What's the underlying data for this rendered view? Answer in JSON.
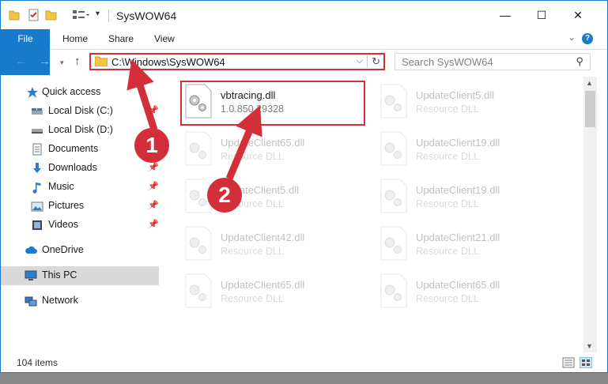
{
  "window": {
    "title": "SysWOW64",
    "controls": {
      "minimize": "—",
      "maximize": "☐",
      "close": "✕"
    }
  },
  "ribbon": {
    "tabs": [
      "File",
      "Home",
      "Share",
      "View"
    ],
    "help": "?"
  },
  "address": {
    "path": "C:\\Windows\\SysWOW64",
    "search_placeholder": "Search SysWOW64"
  },
  "sidebar": {
    "items": [
      {
        "label": "Quick access",
        "icon": "star-icon"
      },
      {
        "label": "Local Disk (C:)",
        "icon": "drive-icon",
        "pinned": true
      },
      {
        "label": "Local Disk (D:)",
        "icon": "drive-icon"
      },
      {
        "label": "Documents",
        "icon": "documents-icon",
        "pinned": true
      },
      {
        "label": "Downloads",
        "icon": "download-icon",
        "pinned": true
      },
      {
        "label": "Music",
        "icon": "music-icon",
        "pinned": true
      },
      {
        "label": "Pictures",
        "icon": "pictures-icon",
        "pinned": true
      },
      {
        "label": "Videos",
        "icon": "videos-icon",
        "pinned": true
      },
      {
        "label": "OneDrive",
        "icon": "cloud-icon"
      },
      {
        "label": "This PC",
        "icon": "computer-icon",
        "selected": true
      },
      {
        "label": "Network",
        "icon": "network-icon"
      }
    ]
  },
  "files": [
    {
      "name": "vbtracing.dll",
      "desc": "1.0.850.29328",
      "highlighted": true
    },
    {
      "name": "UpdateClient5.dll",
      "desc": "Resource DLL"
    },
    {
      "name": "UpdateClient65.dll",
      "desc": "Resource DLL"
    },
    {
      "name": "UpdateClient19.dll",
      "desc": "Resource DLL"
    },
    {
      "name": "UpdateClient5.dll",
      "desc": "Resource DLL"
    },
    {
      "name": "UpdateClient19.dll",
      "desc": "Resource DLL"
    },
    {
      "name": "UpdateClient42.dll",
      "desc": "Resource DLL"
    },
    {
      "name": "UpdateClient21.dll",
      "desc": "Resource DLL"
    },
    {
      "name": "UpdateClient65.dll",
      "desc": "Resource DLL"
    },
    {
      "name": "UpdateClient65.dll",
      "desc": "Resource DLL"
    }
  ],
  "status": {
    "item_count": "104 items"
  },
  "annotations": {
    "marker1": "1",
    "marker2": "2",
    "color": "#d32f3a"
  }
}
